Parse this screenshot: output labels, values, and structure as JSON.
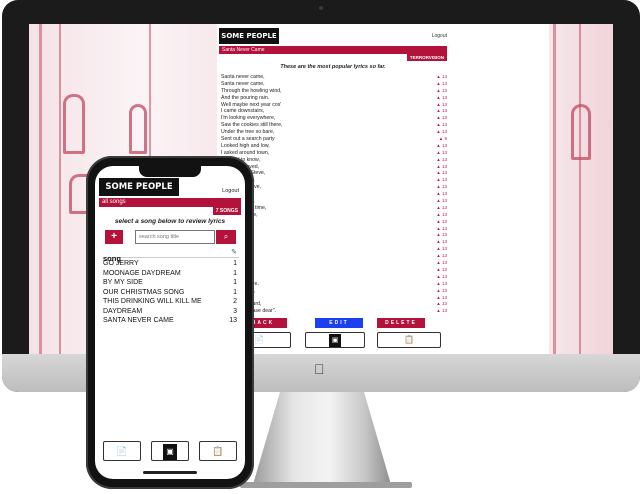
{
  "desktop": {
    "app_title": "SOME PEOPLE SAY",
    "logout_label": "Logout",
    "song_title": "Santa Never Came",
    "band": "TERRORVISION",
    "intro": "These are the most popular lyrics so far.",
    "lyrics": [
      {
        "text": "Santa never came,",
        "votes": "14"
      },
      {
        "text": "Santa never came,",
        "votes": "13"
      },
      {
        "text": "Through the howling wind,",
        "votes": "13"
      },
      {
        "text": "And the pouring rain.",
        "votes": "13"
      },
      {
        "text": "Well maybe next year cos'",
        "votes": "13"
      },
      {
        "text": "I came downstairs,",
        "votes": "13"
      },
      {
        "text": "I'm looking everywhere,",
        "votes": "13"
      },
      {
        "text": "Saw the cookies still there,",
        "votes": "13"
      },
      {
        "text": "Under the tree so bare,",
        "votes": "13"
      },
      {
        "text": "Sent out a search party",
        "votes": "9"
      },
      {
        "text": "Looked high and low,",
        "votes": "13"
      },
      {
        "text": "I asked around town,",
        "votes": "13"
      },
      {
        "text": "seemed to know,",
        "votes": "13"
      },
      {
        "text": "always believed,",
        "votes": "13"
      },
      {
        "text": "Mum's mate Steve,",
        "votes": "13"
      },
      {
        "text": "been so naive,",
        "votes": "13"
      },
      {
        "text": "ys see him leave,",
        "votes": "13"
      },
      {
        "text": "tmas eve,",
        "votes": "13"
      },
      {
        "text": "ss still at work,",
        "votes": "13"
      },
      {
        "text": "will be the last time,",
        "votes": "13"
      },
      {
        "text": "be the last time,",
        "votes": "13"
      },
      {
        "text": "came,",
        "votes": "13"
      },
      {
        "text": "came,",
        "votes": "13"
      },
      {
        "text": "howling wind,",
        "votes": "13"
      },
      {
        "text": "ring rain.",
        "votes": "13"
      },
      {
        "text": "next year cos'",
        "votes": "13"
      },
      {
        "text": "came,",
        "votes": "13"
      },
      {
        "text": "out there,",
        "votes": "13"
      },
      {
        "text": "hide nor hair,",
        "votes": "13"
      },
      {
        "text": "ghfair.",
        "votes": "13"
      },
      {
        "text": "downstairs care,",
        "votes": "13"
      },
      {
        "text": "ve got the fear,",
        "votes": "13"
      },
      {
        "text": "ht last year,",
        "votes": "13"
      },
      {
        "text": "rabbed his beard,",
        "votes": "13"
      },
      {
        "text": "creaming \"please dear\".",
        "votes": "13"
      }
    ],
    "buttons": {
      "back": "BACK",
      "edit": "EDIT",
      "delete": "DELETE"
    },
    "nav": {
      "left_icon": "lyrics-sheet-icon",
      "mid_icon": "radio-icon",
      "right_icon": "clipboard-icon"
    }
  },
  "phone": {
    "app_title": "SOME PEOPLE SAY",
    "logout_label": "Logout",
    "section_title": "all songs",
    "song_count": "7 SONGS",
    "intro": "select a song below to review lyrics",
    "add_icon": "plus-icon",
    "search_placeholder": "search song title",
    "search_icon": "search-icon",
    "table_header": "song",
    "edit_icon": "edit-icon",
    "songs": [
      {
        "title": "GO JERRY",
        "count": "1"
      },
      {
        "title": "MOONAGE DAYDREAM",
        "count": "1"
      },
      {
        "title": "BY MY SIDE",
        "count": "1"
      },
      {
        "title": "OUR CHRISTMAS SONG",
        "count": "1"
      },
      {
        "title": "THIS DRINKING WILL KILL ME",
        "count": "2"
      },
      {
        "title": "DAYDREAM",
        "count": "3"
      },
      {
        "title": "SANTA NEVER CAME",
        "count": "13"
      }
    ]
  },
  "colors": {
    "accent": "#b3123a",
    "edit_blue": "#1c3ff0",
    "brand_dark": "#111111"
  }
}
